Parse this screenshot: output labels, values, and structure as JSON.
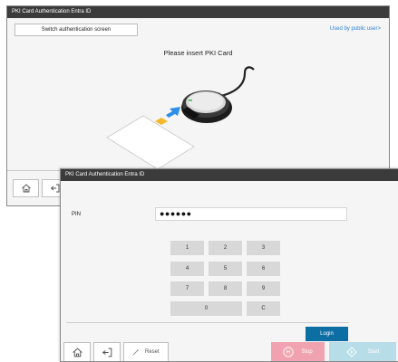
{
  "back_window": {
    "title": "PKI Card Authentication Entra ID",
    "switch_button_label": "Switch authentication screen",
    "public_user_link": "Used by public user>",
    "instruction": "Please insert PKI Card"
  },
  "front_window": {
    "title": "PKI Card Authentication Entra ID",
    "pin_label": "PIN",
    "pin_value": "●●●●●●",
    "keypad": [
      "1",
      "2",
      "3",
      "4",
      "5",
      "6",
      "7",
      "8",
      "9",
      "0",
      "C"
    ],
    "login_label": "Login",
    "reset_label": "Reset",
    "stop_label": "Stop",
    "start_label": "Start"
  },
  "colors": {
    "titlebar": "#3b3b3b",
    "link": "#2b84d6",
    "login": "#0d6ea4",
    "stop": "#f1a2b0",
    "start": "#b7dde8",
    "card_arrow": "#2d8fe6",
    "chip": "#f1b92b"
  },
  "icons": [
    "home-icon",
    "logout-icon",
    "reset-pencil-icon",
    "stop-icon",
    "start-icon",
    "card-reader-icon"
  ]
}
